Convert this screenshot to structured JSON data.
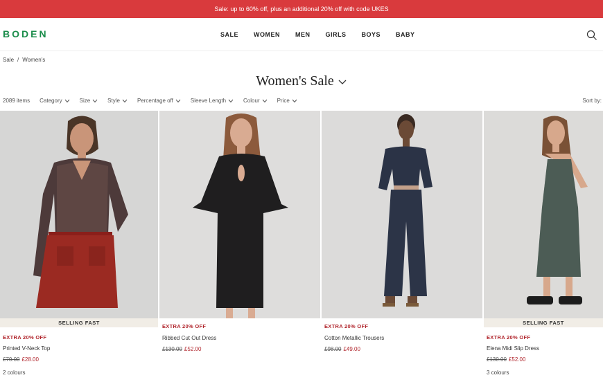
{
  "promo": {
    "text": "Sale: up to 60% off, plus an additional 20% off with code UKES"
  },
  "header": {
    "logo": "BODEN",
    "nav": [
      "SALE",
      "WOMEN",
      "MEN",
      "GIRLS",
      "BOYS",
      "BABY"
    ],
    "search_icon": "search-icon"
  },
  "breadcrumb": [
    "Sale",
    "/",
    "Women's"
  ],
  "page": {
    "title": "Women's Sale"
  },
  "filters": {
    "count": "2089 items",
    "items": [
      "Category",
      "Size",
      "Style",
      "Percentage off",
      "Sleeve Length",
      "Colour",
      "Price"
    ],
    "sort": "Sort by:"
  },
  "products": [
    {
      "badge": "SELLING FAST",
      "extra": "EXTRA 20% OFF",
      "name": "Printed V-Neck Top",
      "old_price": "£70.00",
      "new_price": "£28.00",
      "colours": "2 colours"
    },
    {
      "badge": "",
      "extra": "EXTRA 20% OFF",
      "name": "Ribbed Cut Out Dress",
      "old_price": "£130.00",
      "new_price": "£52.00",
      "colours": ""
    },
    {
      "badge": "",
      "extra": "EXTRA 20% OFF",
      "name": "Cotton Metallic Trousers",
      "old_price": "£98.00",
      "new_price": "£49.00",
      "colours": ""
    },
    {
      "badge": "SELLING FAST",
      "extra": "EXTRA 20% OFF",
      "name": "Elena Midi Slip Dress",
      "old_price": "£130.00",
      "new_price": "£52.00",
      "colours": "3 colours"
    }
  ],
  "colors": {
    "promo": "#d93a3d",
    "logo": "#1a8c4a",
    "sale_price": "#b0242b"
  }
}
